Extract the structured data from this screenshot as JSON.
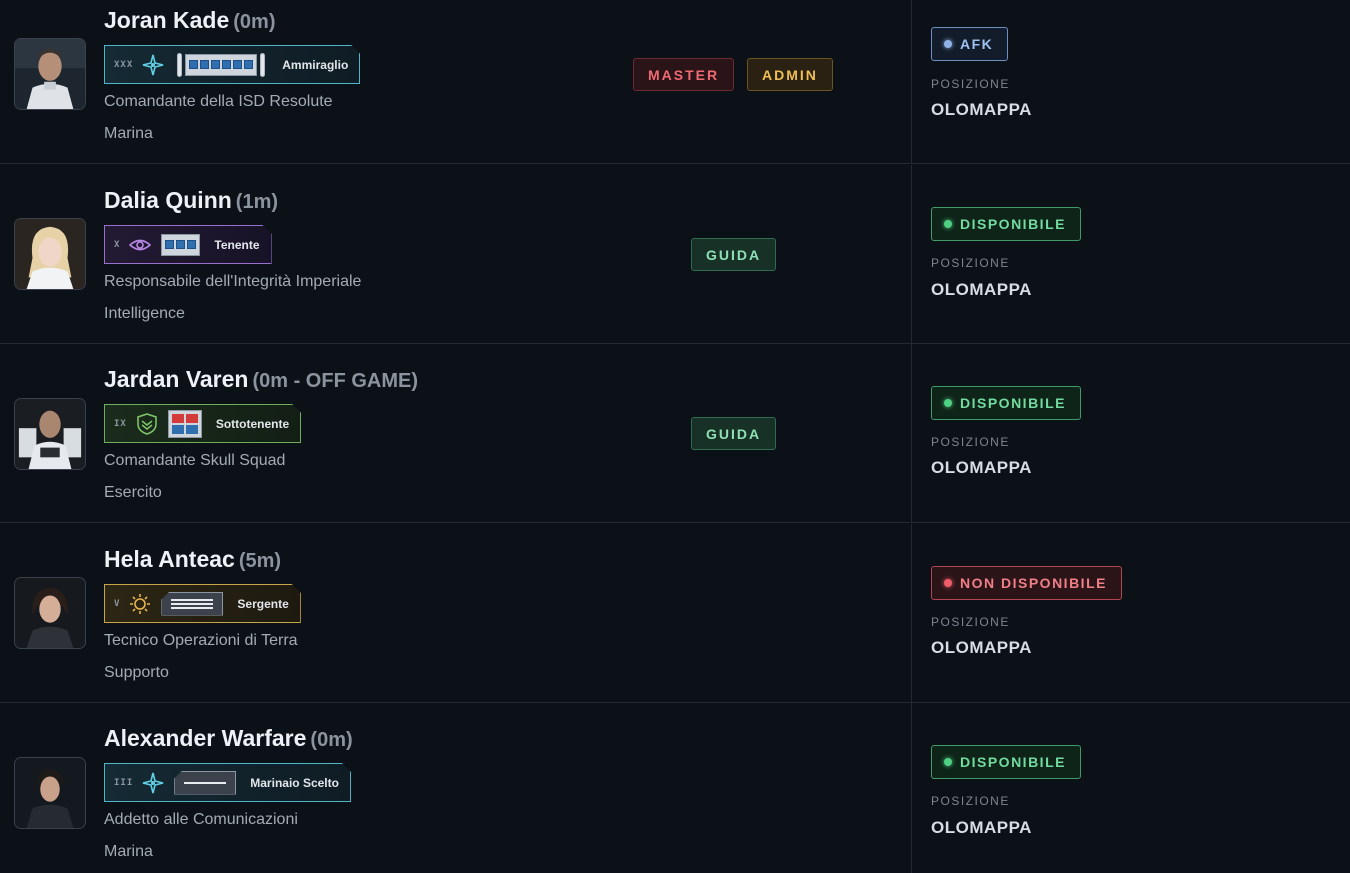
{
  "labels": {
    "position": "POSIZIONE"
  },
  "members": [
    {
      "name": "Joran Kade",
      "time": "(0m)",
      "rank": {
        "numeral": "XXX",
        "label": "Ammiraglio",
        "theme": "cyan",
        "emblem": "starburst-icon"
      },
      "role": "Comandante della ISD Resolute",
      "division": "Marina",
      "tags": [
        "MASTER",
        "ADMIN"
      ],
      "status": "AFK",
      "position": "OLOMAPPA"
    },
    {
      "name": "Dalia Quinn",
      "time": "(1m)",
      "rank": {
        "numeral": "X",
        "label": "Tenente",
        "theme": "purple",
        "emblem": "eye-icon"
      },
      "role": "Responsabile dell'Integrità Imperiale",
      "division": "Intelligence",
      "tags": [
        "GUIDA"
      ],
      "status": "DISPONIBILE",
      "position": "OLOMAPPA"
    },
    {
      "name": "Jardan Varen",
      "time": "(0m - OFF GAME)",
      "rank": {
        "numeral": "IX",
        "label": "Sottotenente",
        "theme": "green",
        "emblem": "chevron-shield-icon"
      },
      "role": "Comandante Skull Squad",
      "division": "Esercito",
      "tags": [
        "GUIDA"
      ],
      "status": "DISPONIBILE",
      "position": "OLOMAPPA"
    },
    {
      "name": "Hela Anteac",
      "time": "(5m)",
      "rank": {
        "numeral": "V",
        "label": "Sergente",
        "theme": "gold",
        "emblem": "sun-gear-icon"
      },
      "role": "Tecnico Operazioni di Terra",
      "division": "Supporto",
      "tags": [],
      "status": "NON DISPONIBILE",
      "position": "OLOMAPPA"
    },
    {
      "name": "Alexander Warfare",
      "time": "(0m)",
      "rank": {
        "numeral": "III",
        "label": "Marinaio Scelto",
        "theme": "cyan",
        "emblem": "starburst-icon"
      },
      "role": "Addetto alle Comunicazioni",
      "division": "Marina",
      "tags": [],
      "status": "DISPONIBILE",
      "position": "OLOMAPPA"
    }
  ]
}
